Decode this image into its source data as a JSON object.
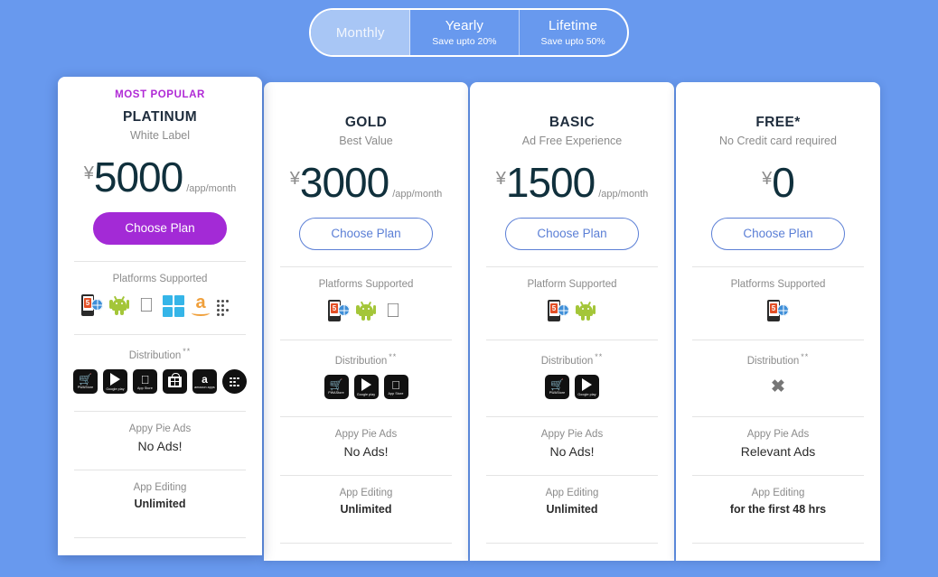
{
  "background_color": "#6899ee",
  "billing_toggle": {
    "options": [
      {
        "label": "Monthly",
        "sub": "",
        "active": true
      },
      {
        "label": "Yearly",
        "sub": "Save upto 20%",
        "active": false
      },
      {
        "label": "Lifetime",
        "sub": "Save upto 50%",
        "active": false
      }
    ]
  },
  "section_titles": {
    "distribution_stars": "**",
    "appy_pie_ads": "Appy Pie Ads",
    "app_editing": "App Editing"
  },
  "plans": [
    {
      "badge": "MOST POPULAR",
      "accent": "#a32ad6",
      "name": "PLATINUM",
      "tagline": "White Label",
      "currency": "¥",
      "amount": "5000",
      "per": "/app/month",
      "cta_label": "Choose Plan",
      "cta_style": "primary",
      "platforms_title": "Platforms Supported",
      "platforms": [
        "web-html5-icon",
        "android-icon",
        "apple-icon",
        "windows-icon",
        "amazon-icon",
        "blackberry-icon"
      ],
      "distribution_title": "Distribution",
      "distribution": [
        "pwastore-badge",
        "google-play-badge",
        "app-store-badge",
        "windows-store-badge",
        "amazon-appstore-badge",
        "blackberry-world-badge"
      ],
      "ads_label": "Appy Pie Ads",
      "ads_value": "No Ads!",
      "editing_label": "App Editing",
      "editing_value": "Unlimited"
    },
    {
      "badge": "",
      "accent": "#5b7fd6",
      "name": "GOLD",
      "tagline": "Best Value",
      "currency": "¥",
      "amount": "3000",
      "per": "/app/month",
      "cta_label": "Choose Plan",
      "cta_style": "outline",
      "platforms_title": "Platforms Supported",
      "platforms": [
        "web-html5-icon",
        "android-icon",
        "apple-icon"
      ],
      "distribution_title": "Distribution",
      "distribution": [
        "pwastore-badge",
        "google-play-badge",
        "app-store-badge"
      ],
      "ads_label": "Appy Pie Ads",
      "ads_value": "No Ads!",
      "editing_label": "App Editing",
      "editing_value": "Unlimited"
    },
    {
      "badge": "",
      "accent": "#5b7fd6",
      "name": "BASIC",
      "tagline": "Ad Free Experience",
      "currency": "¥",
      "amount": "1500",
      "per": "/app/month",
      "cta_label": "Choose Plan",
      "cta_style": "outline",
      "platforms_title": "Platform Supported",
      "platforms": [
        "web-html5-icon",
        "android-icon"
      ],
      "distribution_title": "Distribution",
      "distribution": [
        "pwastore-badge",
        "google-play-badge"
      ],
      "ads_label": "Appy Pie Ads",
      "ads_value": "No Ads!",
      "editing_label": "App Editing",
      "editing_value": "Unlimited"
    },
    {
      "badge": "",
      "accent": "#5b7fd6",
      "name": "FREE*",
      "tagline": "No Credit card required",
      "currency": "¥",
      "amount": "0",
      "per": "",
      "cta_label": "Choose Plan",
      "cta_style": "outline",
      "platforms_title": "Platforms Supported",
      "platforms": [
        "web-html5-icon"
      ],
      "distribution_title": "Distribution",
      "distribution": [],
      "distribution_none_glyph": "✖",
      "ads_label": "Appy Pie Ads",
      "ads_value": "Relevant Ads",
      "editing_label": "App Editing",
      "editing_value": "for the first 48 hrs"
    }
  ]
}
